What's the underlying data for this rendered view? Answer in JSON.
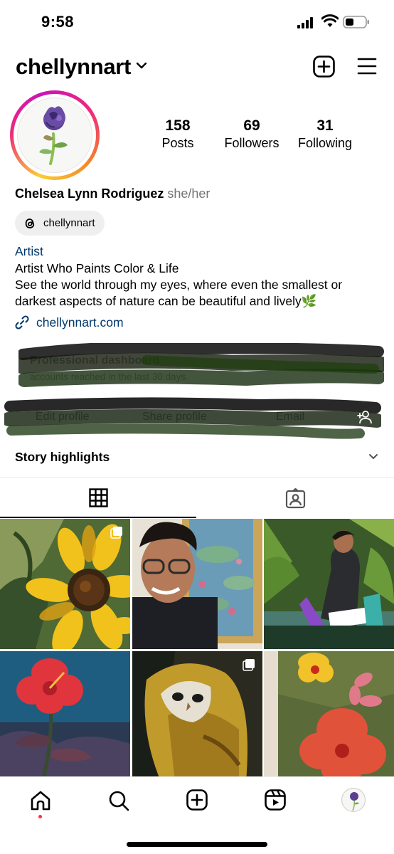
{
  "status": {
    "time": "9:58"
  },
  "header": {
    "username": "chellynnart"
  },
  "profile": {
    "full_name": "Chelsea Lynn Rodriguez",
    "pronouns": "she/her",
    "threads_handle": "chellynnart",
    "category": "Artist",
    "bio_line1": "Artist Who Paints Color & Life",
    "bio_line2": "See the world through my eyes, where even the smallest or",
    "bio_line3": "darkest aspects of nature can be beautiful and lively🌿",
    "link": "chellynnart.com"
  },
  "stats": {
    "posts_count": "158",
    "posts_label": "Posts",
    "followers_count": "69",
    "followers_label": "Followers",
    "following_count": "31",
    "following_label": "Following"
  },
  "dashboard": {
    "title": "Professional dashboard",
    "subtitle": "accounts reached in the last 30 days."
  },
  "actions": {
    "edit_label": "Edit profile",
    "share_label": "Share profile",
    "email_label": "Email"
  },
  "highlights": {
    "label": "Story highlights"
  },
  "tabs": [
    {
      "icon": "grid-icon",
      "active": true
    },
    {
      "icon": "tagged-icon",
      "active": false
    }
  ],
  "posts": [
    {
      "subject": "sunflower-painting",
      "multi": true
    },
    {
      "subject": "selfie-with-water-lilies-painting",
      "multi": false
    },
    {
      "subject": "artist-sketching-in-garden",
      "multi": false
    },
    {
      "subject": "red-hibiscus-painting",
      "multi": false
    },
    {
      "subject": "barn-owl-painting",
      "multi": true
    },
    {
      "subject": "orange-flowers-painting",
      "multi": false
    }
  ],
  "colors": {
    "link_blue": "#00376b",
    "muted_gray": "#737373",
    "pill_gray": "#efefef",
    "notification_red": "#ff3040"
  }
}
